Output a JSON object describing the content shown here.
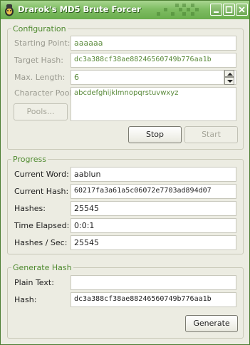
{
  "window": {
    "title": "Drarok's MD5 Brute Forcer",
    "accent": "#6aad4d"
  },
  "config": {
    "legend": "Configuration",
    "starting_point": {
      "label": "Starting Point:",
      "value": "aaaaaa"
    },
    "target_hash": {
      "label": "Target Hash:",
      "value": "dc3a388cf38ae88246560749b776aa1b"
    },
    "max_length": {
      "label": "Max. Length:",
      "value": "6"
    },
    "char_pool": {
      "label": "Character Pool:",
      "value": "abcdefghijklmnopqrstuvwxyz"
    },
    "pools_button": "Pools...",
    "stop_button": "Stop",
    "start_button": "Start"
  },
  "progress": {
    "legend": "Progress",
    "current_word": {
      "label": "Current Word:",
      "value": "aablun"
    },
    "current_hash": {
      "label": "Current Hash:",
      "value": "60217fa3a61a5c06072e7703ad894d07"
    },
    "hashes": {
      "label": "Hashes:",
      "value": "25545"
    },
    "time_elapsed": {
      "label": "Time Elapsed:",
      "value": "0:0:1"
    },
    "hashes_per_sec": {
      "label": "Hashes / Sec:",
      "value": "25545"
    }
  },
  "generate": {
    "legend": "Generate Hash",
    "plain_text": {
      "label": "Plain Text:",
      "value": ""
    },
    "hash": {
      "label": "Hash:",
      "value": "dc3a388cf38ae88246560749b776aa1b"
    },
    "generate_button": "Generate"
  }
}
